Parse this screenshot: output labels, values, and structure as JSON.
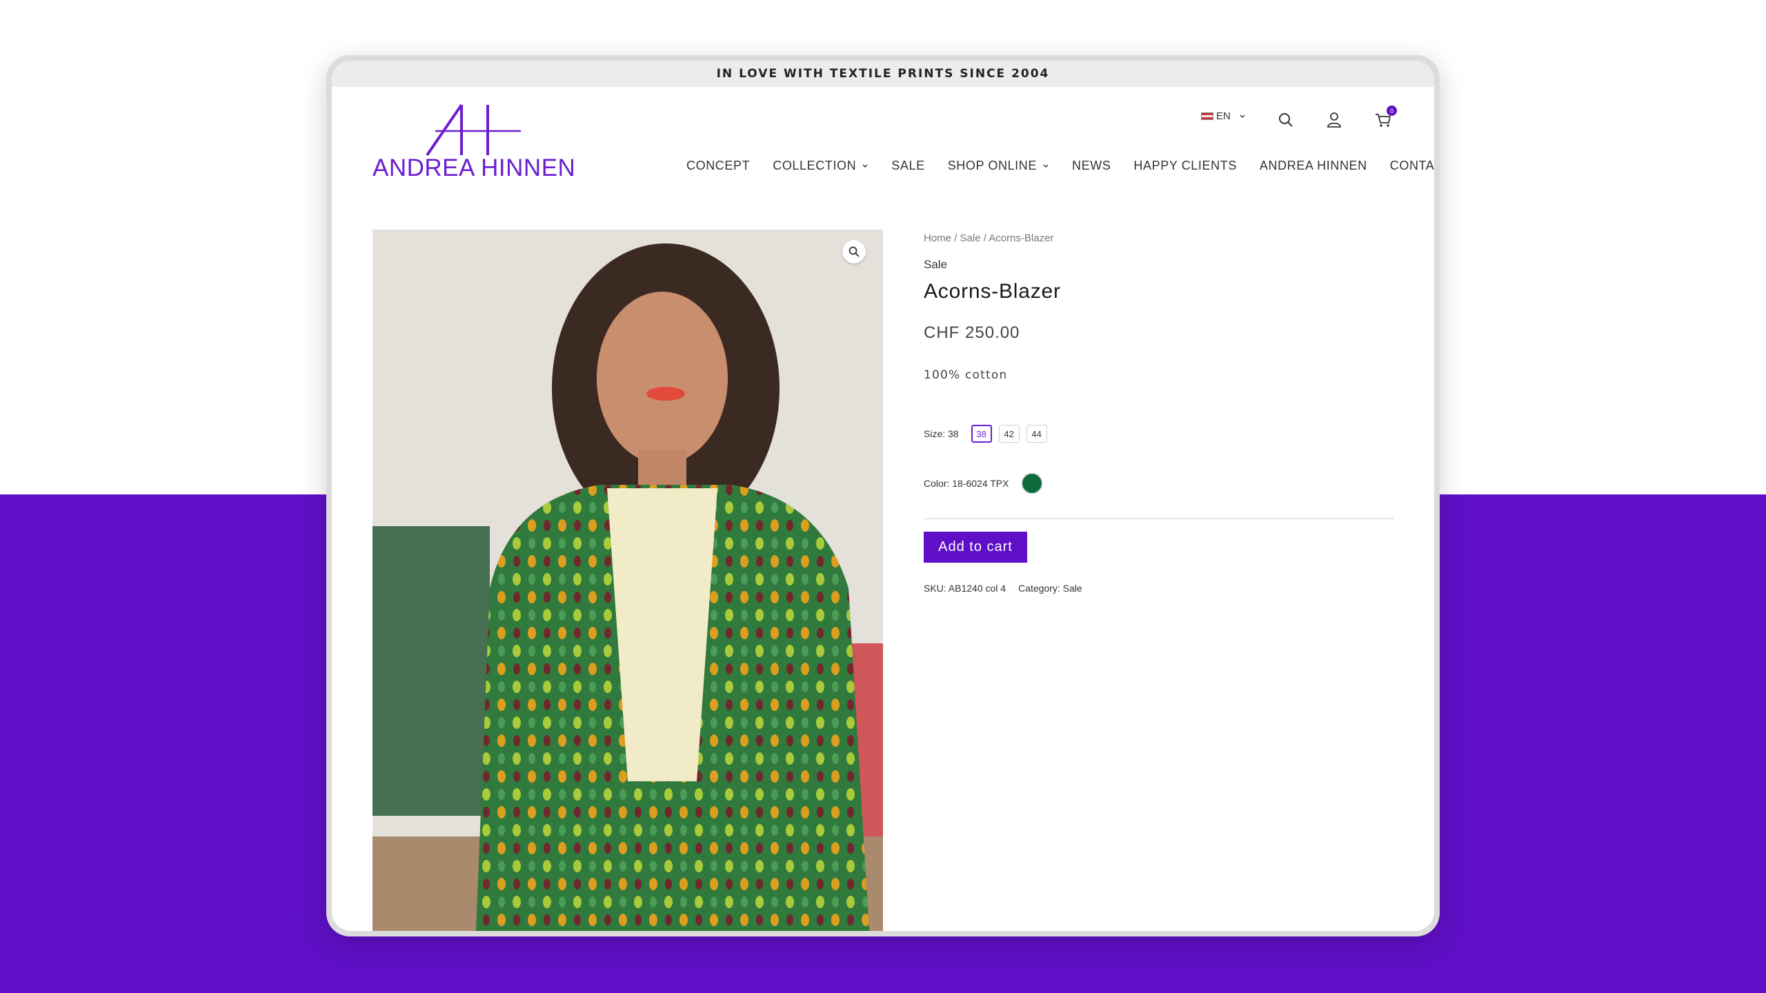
{
  "topbar": {
    "text": "IN LOVE WITH TEXTILE PRINTS SINCE 2004"
  },
  "logo": {
    "text": "ANDREA HINNEN"
  },
  "header": {
    "language": "EN",
    "cart_count": "0"
  },
  "nav": {
    "items": [
      {
        "label": "CONCEPT"
      },
      {
        "label": "COLLECTION"
      },
      {
        "label": "SALE"
      },
      {
        "label": "SHOP ONLINE"
      },
      {
        "label": "NEWS"
      },
      {
        "label": "HAPPY CLIENTS"
      },
      {
        "label": "ANDREA HINNEN"
      },
      {
        "label": "CONTACT"
      }
    ]
  },
  "product": {
    "breadcrumb": "Home / Sale / Acorns-Blazer",
    "category_tag": "Sale",
    "title": "Acorns-Blazer",
    "price": "CHF 250.00",
    "description": "100% cotton",
    "size_label": "Size: 38",
    "sizes": [
      "38",
      "42",
      "44"
    ],
    "selected_size": "38",
    "color_label": "Color: 18-6024 TPX",
    "color_hex": "#0f6b3d",
    "add_to_cart": "Add to cart",
    "sku": "SKU: AB1240 col 4",
    "category": "Category: Sale"
  },
  "colors": {
    "accent": "#5f10c6",
    "brand": "#6a1fd0"
  }
}
